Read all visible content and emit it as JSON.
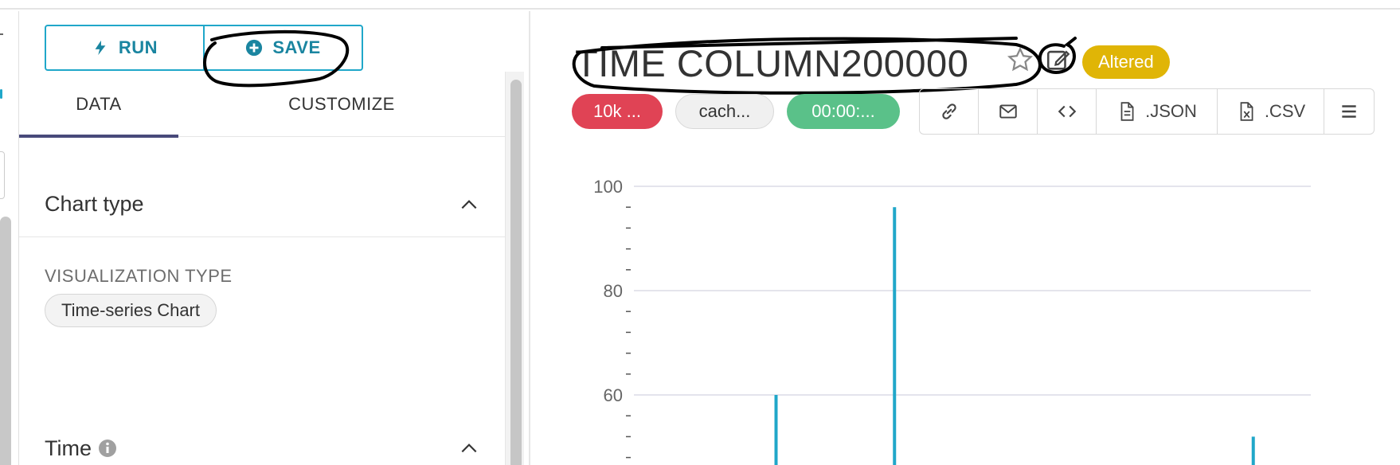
{
  "control_panel": {
    "run_label": "RUN",
    "save_label": "SAVE",
    "tabs": [
      "DATA",
      "CUSTOMIZE"
    ],
    "sections": {
      "chart_type": "Chart type",
      "viz_type_label": "VISUALIZATION TYPE",
      "viz_type_value": "Time-series Chart",
      "time": "Time"
    }
  },
  "chart_header": {
    "title": "TIME COLUMN200000",
    "altered_label": "Altered",
    "badges": {
      "rows": "10k ...",
      "cache": "cach...",
      "duration": "00:00:..."
    },
    "toolbar": {
      "json_label": ".JSON",
      "csv_label": ".CSV"
    }
  },
  "colors": {
    "primary": "#20a7c9",
    "danger": "#e04355",
    "success": "#5ac189",
    "warning": "#e0b506",
    "tab_indicator": "#484a7a"
  },
  "chart_data": {
    "type": "bar",
    "y_ticks": [
      100,
      80,
      60
    ],
    "ylim": [
      48,
      100
    ],
    "grid": true,
    "bars": [
      {
        "x": 0.21,
        "value": 60
      },
      {
        "x": 0.385,
        "value": 96
      },
      {
        "x": 0.915,
        "value": 52
      }
    ],
    "color": "#20a7c9"
  }
}
